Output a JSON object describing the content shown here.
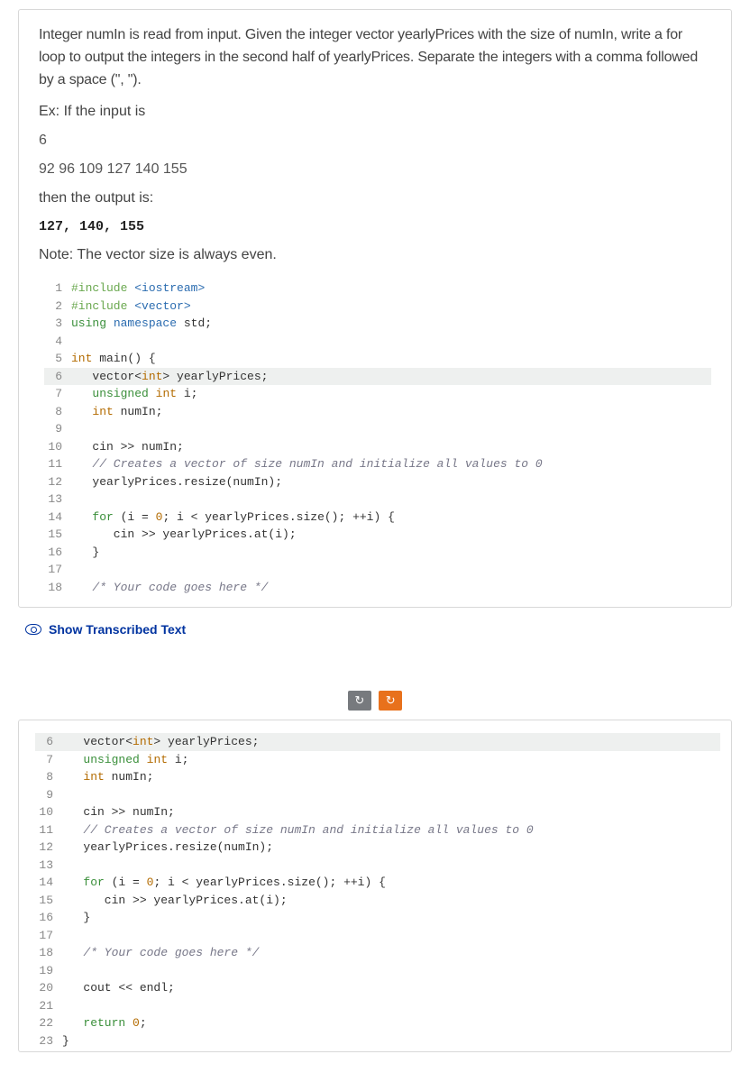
{
  "problem": {
    "prompt": "Integer numIn is read from input. Given the integer vector yearlyPrices with the size of numIn, write a for loop to output the integers in the second half of yearlyPrices. Separate the integers with a comma followed by a space (\", \").",
    "ex_label": "Ex: If the input is",
    "input_line1": "6",
    "input_line2": "92 96 109 127 140 155",
    "then_label": "then the output is:",
    "output": "127, 140, 155",
    "note": "Note: The vector size is always even."
  },
  "code1": [
    {
      "n": "1",
      "hl": false,
      "html": "<span class='kw-include'>#include</span> <span class='kw-blue'>&lt;iostream&gt;</span>"
    },
    {
      "n": "2",
      "hl": false,
      "html": "<span class='kw-include'>#include</span> <span class='kw-blue'>&lt;vector&gt;</span>"
    },
    {
      "n": "3",
      "hl": false,
      "html": "<span class='kw-green'>using</span> <span class='kw-blue'>namespace</span> std;"
    },
    {
      "n": "4",
      "hl": false,
      "html": ""
    },
    {
      "n": "5",
      "hl": false,
      "html": "<span class='kw-type'>int</span> main() {"
    },
    {
      "n": "6",
      "hl": true,
      "html": "   vector&lt;<span class='kw-type'>int</span>&gt; yearlyPrices;"
    },
    {
      "n": "7",
      "hl": false,
      "html": "   <span class='kw-green'>unsigned</span> <span class='kw-type'>int</span> i;"
    },
    {
      "n": "8",
      "hl": false,
      "html": "   <span class='kw-type'>int</span> numIn;"
    },
    {
      "n": "9",
      "hl": false,
      "html": ""
    },
    {
      "n": "10",
      "hl": false,
      "html": "   cin &gt;&gt; numIn;"
    },
    {
      "n": "11",
      "hl": false,
      "html": "   <span class='comment'>// Creates a vector of size numIn and initialize all values to 0</span>"
    },
    {
      "n": "12",
      "hl": false,
      "html": "   yearlyPrices.resize(numIn);"
    },
    {
      "n": "13",
      "hl": false,
      "html": ""
    },
    {
      "n": "14",
      "hl": false,
      "html": "   <span class='kw-green'>for</span> (i = <span class='num'>0</span>; i &lt; yearlyPrices.size(); ++i) {"
    },
    {
      "n": "15",
      "hl": false,
      "html": "      cin &gt;&gt; yearlyPrices.at(i);"
    },
    {
      "n": "16",
      "hl": false,
      "html": "   }"
    },
    {
      "n": "17",
      "hl": false,
      "html": ""
    },
    {
      "n": "18",
      "hl": false,
      "html": "   <span class='comment'>/* Your code goes here */</span>"
    }
  ],
  "show_transcribed": "Show Transcribed Text",
  "buttons": {
    "undo_glyph": "↻",
    "redo_glyph": "↻"
  },
  "code2": [
    {
      "n": "6",
      "hl": true,
      "html": "   vector&lt;<span class='kw-type'>int</span>&gt; yearlyPrices;"
    },
    {
      "n": "7",
      "hl": false,
      "html": "   <span class='kw-green'>unsigned</span> <span class='kw-type'>int</span> i;"
    },
    {
      "n": "8",
      "hl": false,
      "html": "   <span class='kw-type'>int</span> numIn;"
    },
    {
      "n": "9",
      "hl": false,
      "html": ""
    },
    {
      "n": "10",
      "hl": false,
      "html": "   cin &gt;&gt; numIn;"
    },
    {
      "n": "11",
      "hl": false,
      "html": "   <span class='comment'>// Creates a vector of size numIn and initialize all values to 0</span>"
    },
    {
      "n": "12",
      "hl": false,
      "html": "   yearlyPrices.resize(numIn);"
    },
    {
      "n": "13",
      "hl": false,
      "html": ""
    },
    {
      "n": "14",
      "hl": false,
      "html": "   <span class='kw-green'>for</span> (i = <span class='num'>0</span>; i &lt; yearlyPrices.size(); ++i) {"
    },
    {
      "n": "15",
      "hl": false,
      "html": "      cin &gt;&gt; yearlyPrices.at(i);"
    },
    {
      "n": "16",
      "hl": false,
      "html": "   }"
    },
    {
      "n": "17",
      "hl": false,
      "html": ""
    },
    {
      "n": "18",
      "hl": false,
      "html": "   <span class='comment'>/* Your code goes here */</span>"
    },
    {
      "n": "19",
      "hl": false,
      "html": ""
    },
    {
      "n": "20",
      "hl": false,
      "html": "   cout &lt;&lt; endl;"
    },
    {
      "n": "21",
      "hl": false,
      "html": ""
    },
    {
      "n": "22",
      "hl": false,
      "html": "   <span class='kw-green'>return</span> <span class='num'>0</span>;"
    },
    {
      "n": "23",
      "hl": false,
      "html": "}"
    }
  ]
}
